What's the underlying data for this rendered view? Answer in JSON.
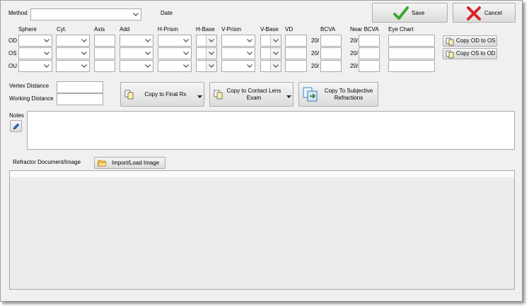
{
  "header": {
    "method_label": "Method",
    "method_value": "",
    "date_label": "Date"
  },
  "actions": {
    "save_label": "Save",
    "cancel_label": "Cancel"
  },
  "grid": {
    "columns": {
      "sphere": "Sphere",
      "cyl": "Cyl.",
      "axis": "Axis",
      "add": "Add",
      "hprism": "H-Prism",
      "hbase": "H-Base",
      "vprism": "V-Prism",
      "vbase": "V-Base",
      "vd": "VD",
      "bcva": "BCVA",
      "near_bcva": "Near BCVA",
      "eye_chart": "Eye Chart"
    },
    "rows": [
      {
        "label": "OD"
      },
      {
        "label": "OS"
      },
      {
        "label": "OU"
      }
    ],
    "acuity_prefix": "20/"
  },
  "copy_buttons": {
    "od_to_os": "Copy OD to OS",
    "os_to_od": "Copy OS to OD"
  },
  "distances": {
    "vertex_label": "Vertex Distance",
    "working_label": "Working Distance"
  },
  "toolbar": {
    "final_rx": "Copy to Final Rx",
    "contact_lens": "Copy to Contact Lens Exam",
    "subjective": "Copy To Subjective Refractions"
  },
  "notes": {
    "label": "Notes",
    "value": ""
  },
  "refractor": {
    "label": "Refractor Document/Image",
    "import_label": "Import/Load Image"
  },
  "colors": {
    "panel": "#f0f0f0",
    "save_check": "#3aa635",
    "cancel_x": "#d9232a",
    "border": "#a9a9a9"
  }
}
